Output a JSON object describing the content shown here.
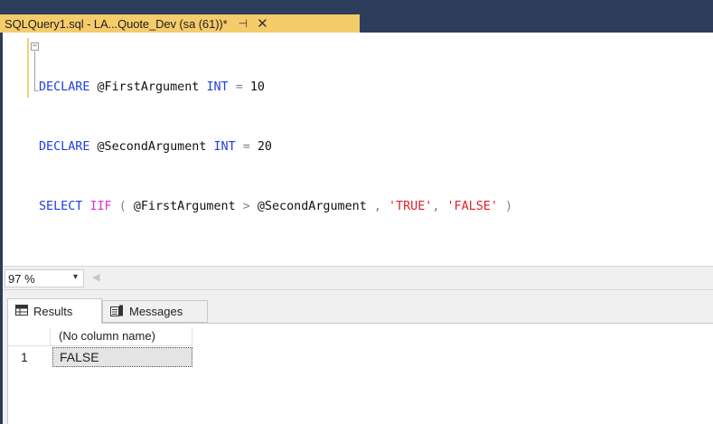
{
  "document_tab": {
    "title": "SQLQuery1.sql - LA...Quote_Dev (sa (61))*",
    "pin_icon": "pin-icon",
    "close_icon": "close-icon"
  },
  "editor": {
    "line1": {
      "kw1": "DECLARE",
      "var": "@FirstArgument",
      "type": "INT",
      "op": "=",
      "num": "10"
    },
    "line2": {
      "kw1": "DECLARE",
      "var": "@SecondArgument",
      "type": "INT",
      "op": "=",
      "num": "20"
    },
    "line3": {
      "kw1": "SELECT",
      "fn": "IIF",
      "paren_open": "(",
      "arg1": "@FirstArgument",
      "op": ">",
      "arg2": "@SecondArgument",
      "comma1": ",",
      "str1": "'TRUE'",
      "comma2": ",",
      "str2": "'FALSE'",
      "paren_close": ")"
    },
    "fold_glyph": "−"
  },
  "zoom": {
    "value": "97 %",
    "arrow": "▾",
    "scroll_left": "◀"
  },
  "results_tabs": {
    "results_label": "Results",
    "messages_label": "Messages"
  },
  "grid": {
    "column_header": "(No column name)",
    "rows": [
      {
        "num": "1",
        "value": "FALSE"
      }
    ]
  },
  "colors": {
    "keyword": "#1f40e0",
    "function": "#e02ee0",
    "string": "#e0202c",
    "operator": "#808080",
    "tab_active": "#f5cc6a",
    "tab_strip": "#2d3e5c"
  }
}
